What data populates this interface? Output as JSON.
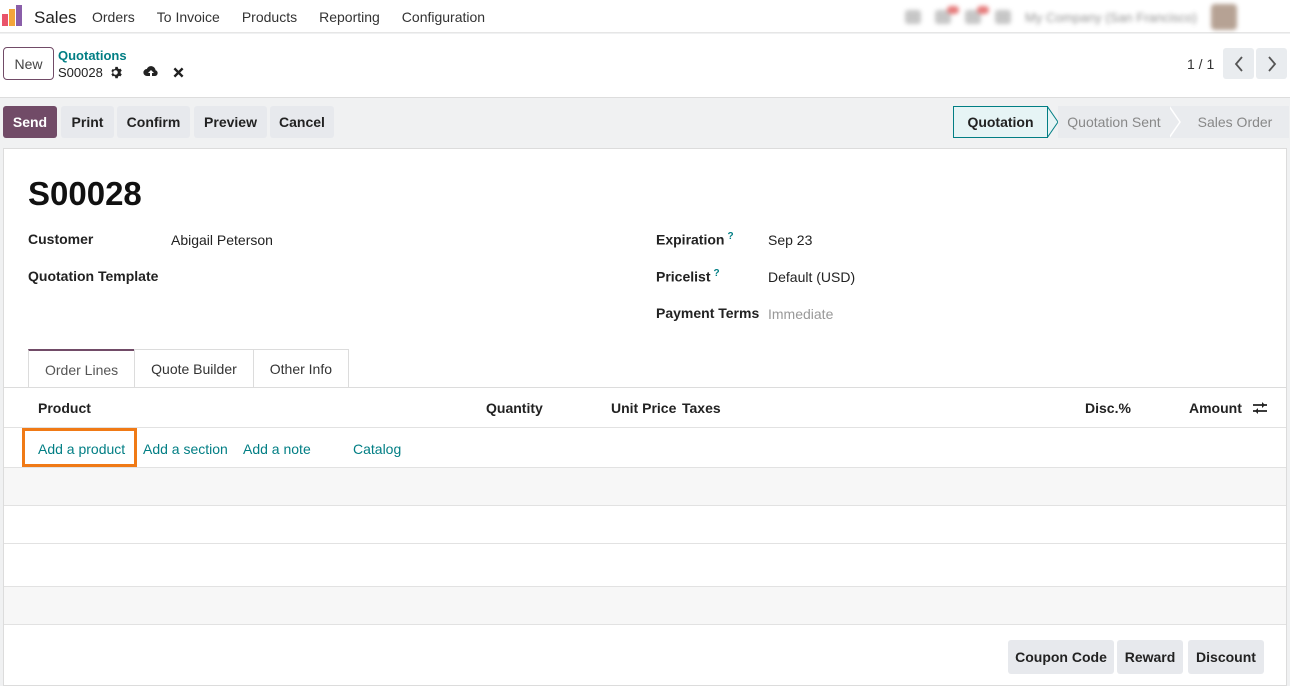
{
  "navbar": {
    "app_name": "Sales",
    "menu": [
      "Orders",
      "To Invoice",
      "Products",
      "Reporting",
      "Configuration"
    ],
    "company": "My Company (San Francisco)"
  },
  "control": {
    "new_label": "New",
    "breadcrumb_parent": "Quotations",
    "breadcrumb_current": "S00028",
    "pager": "1 / 1"
  },
  "actions": {
    "send": "Send",
    "print": "Print",
    "confirm": "Confirm",
    "preview": "Preview",
    "cancel": "Cancel"
  },
  "stages": [
    "Quotation",
    "Quotation Sent",
    "Sales Order"
  ],
  "form": {
    "reference": "S00028",
    "customer_label": "Customer",
    "customer_value": "Abigail Peterson",
    "template_label": "Quotation Template",
    "expiration_label": "Expiration",
    "expiration_value": "Sep 23",
    "pricelist_label": "Pricelist",
    "pricelist_value": "Default (USD)",
    "payment_terms_label": "Payment Terms",
    "payment_terms_placeholder": "Immediate",
    "help_mark": "?"
  },
  "tabs": [
    "Order Lines",
    "Quote Builder",
    "Other Info"
  ],
  "order_lines": {
    "columns": {
      "product": "Product",
      "quantity": "Quantity",
      "unit_price": "Unit Price",
      "taxes": "Taxes",
      "disc": "Disc.%",
      "amount": "Amount"
    },
    "add_product": "Add a product",
    "add_section": "Add a section",
    "add_note": "Add a note",
    "catalog": "Catalog"
  },
  "footer_buttons": {
    "coupon": "Coupon Code",
    "reward": "Reward",
    "discount": "Discount"
  },
  "colors": {
    "brand": "#714b67",
    "link": "#017e84",
    "highlight": "#f07a16"
  }
}
